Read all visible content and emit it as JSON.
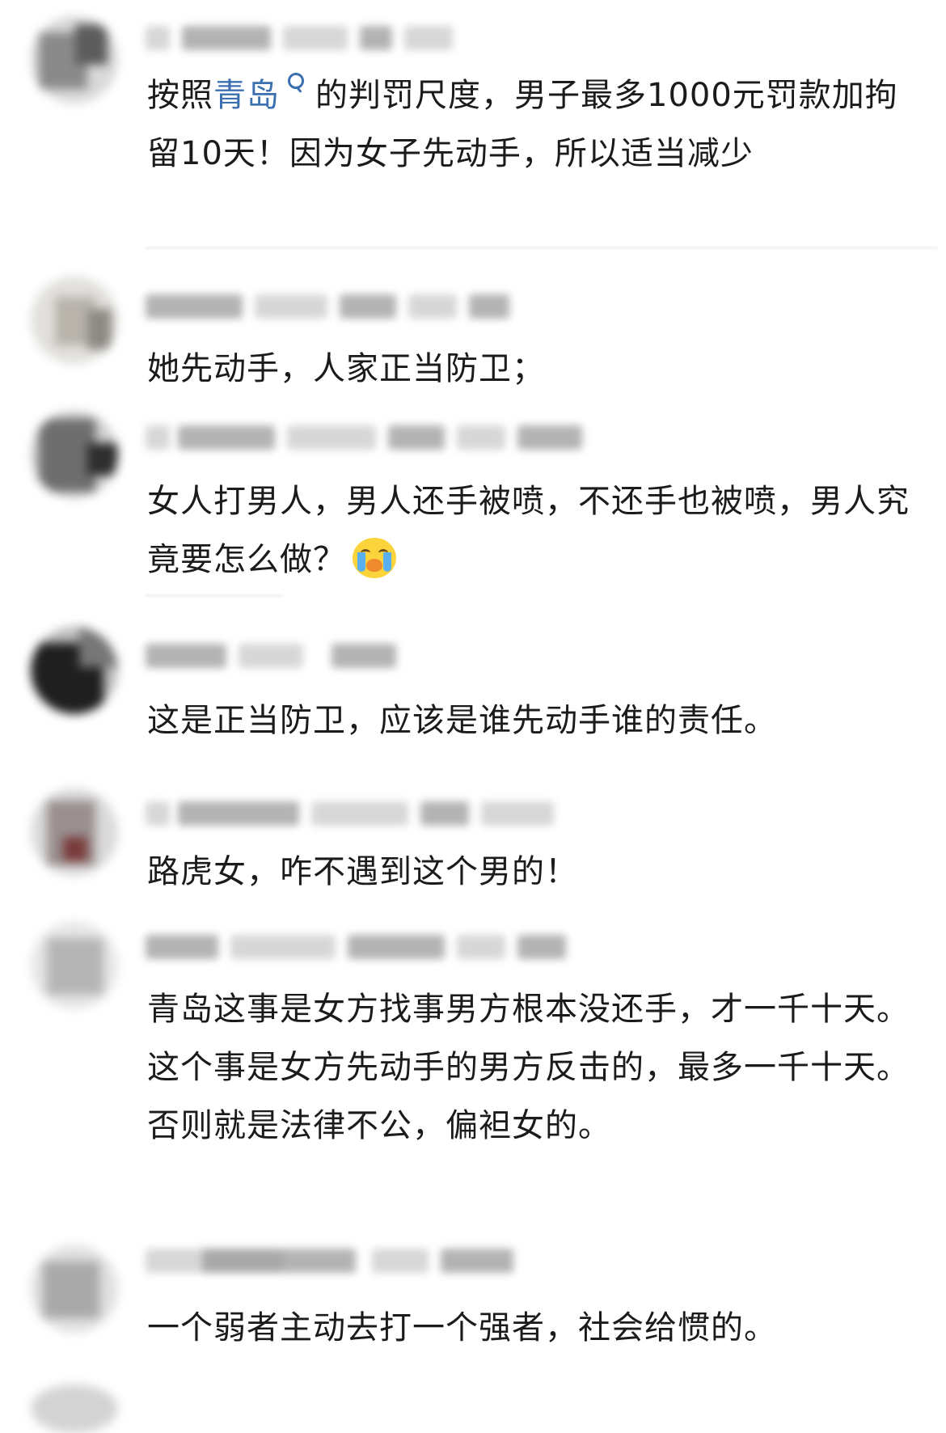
{
  "comments": [
    {
      "text_parts": [
        "按照",
        "青岛",
        "的判罚尺度，男子最多1000元罚款加拘留10天！因为女子先动手，所以适当减少"
      ],
      "search_icon": "search-icon"
    },
    {
      "text": "她先动手，人家正当防卫；"
    },
    {
      "text": "女人打男人，男人还手被喷，不还手也被喷，男人究竟要怎么做？",
      "emoji": "crying-face-emoji"
    },
    {
      "text": "这是正当防卫，应该是谁先动手谁的责任。"
    },
    {
      "text": "路虎女，咋不遇到这个男的！"
    },
    {
      "text": "青岛这事是女方找事男方根本没还手，才一千十天。这个事是女方先动手的男方反击的，最多一千十天。否则就是法律不公，偏袒女的。"
    },
    {
      "text": "一个弱者主动去打一个强者，社会给惯的。"
    }
  ],
  "colors": {
    "text": "#1b1b1b",
    "link": "#3b6fb0",
    "background": "#ffffff"
  }
}
